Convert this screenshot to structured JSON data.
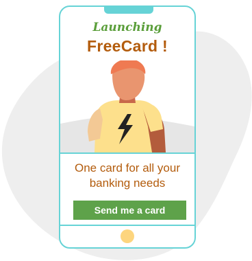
{
  "promo": {
    "kicker": "Launching",
    "title": "FreeCard !",
    "tagline_line1": "One card for all your",
    "tagline_line2": "banking needs",
    "cta_label": "Send me a card"
  },
  "illustration": {
    "subject": "person wearing a shirt with a lightning-bolt logo",
    "icon": "lightning-bolt-icon"
  },
  "colors": {
    "phone_outline": "#66d3d6",
    "kicker": "#5a9e3a",
    "title": "#b35c0d",
    "cta_background": "#5ea24a",
    "home_button": "#fdd57e",
    "background_blob": "#eeeeee"
  }
}
